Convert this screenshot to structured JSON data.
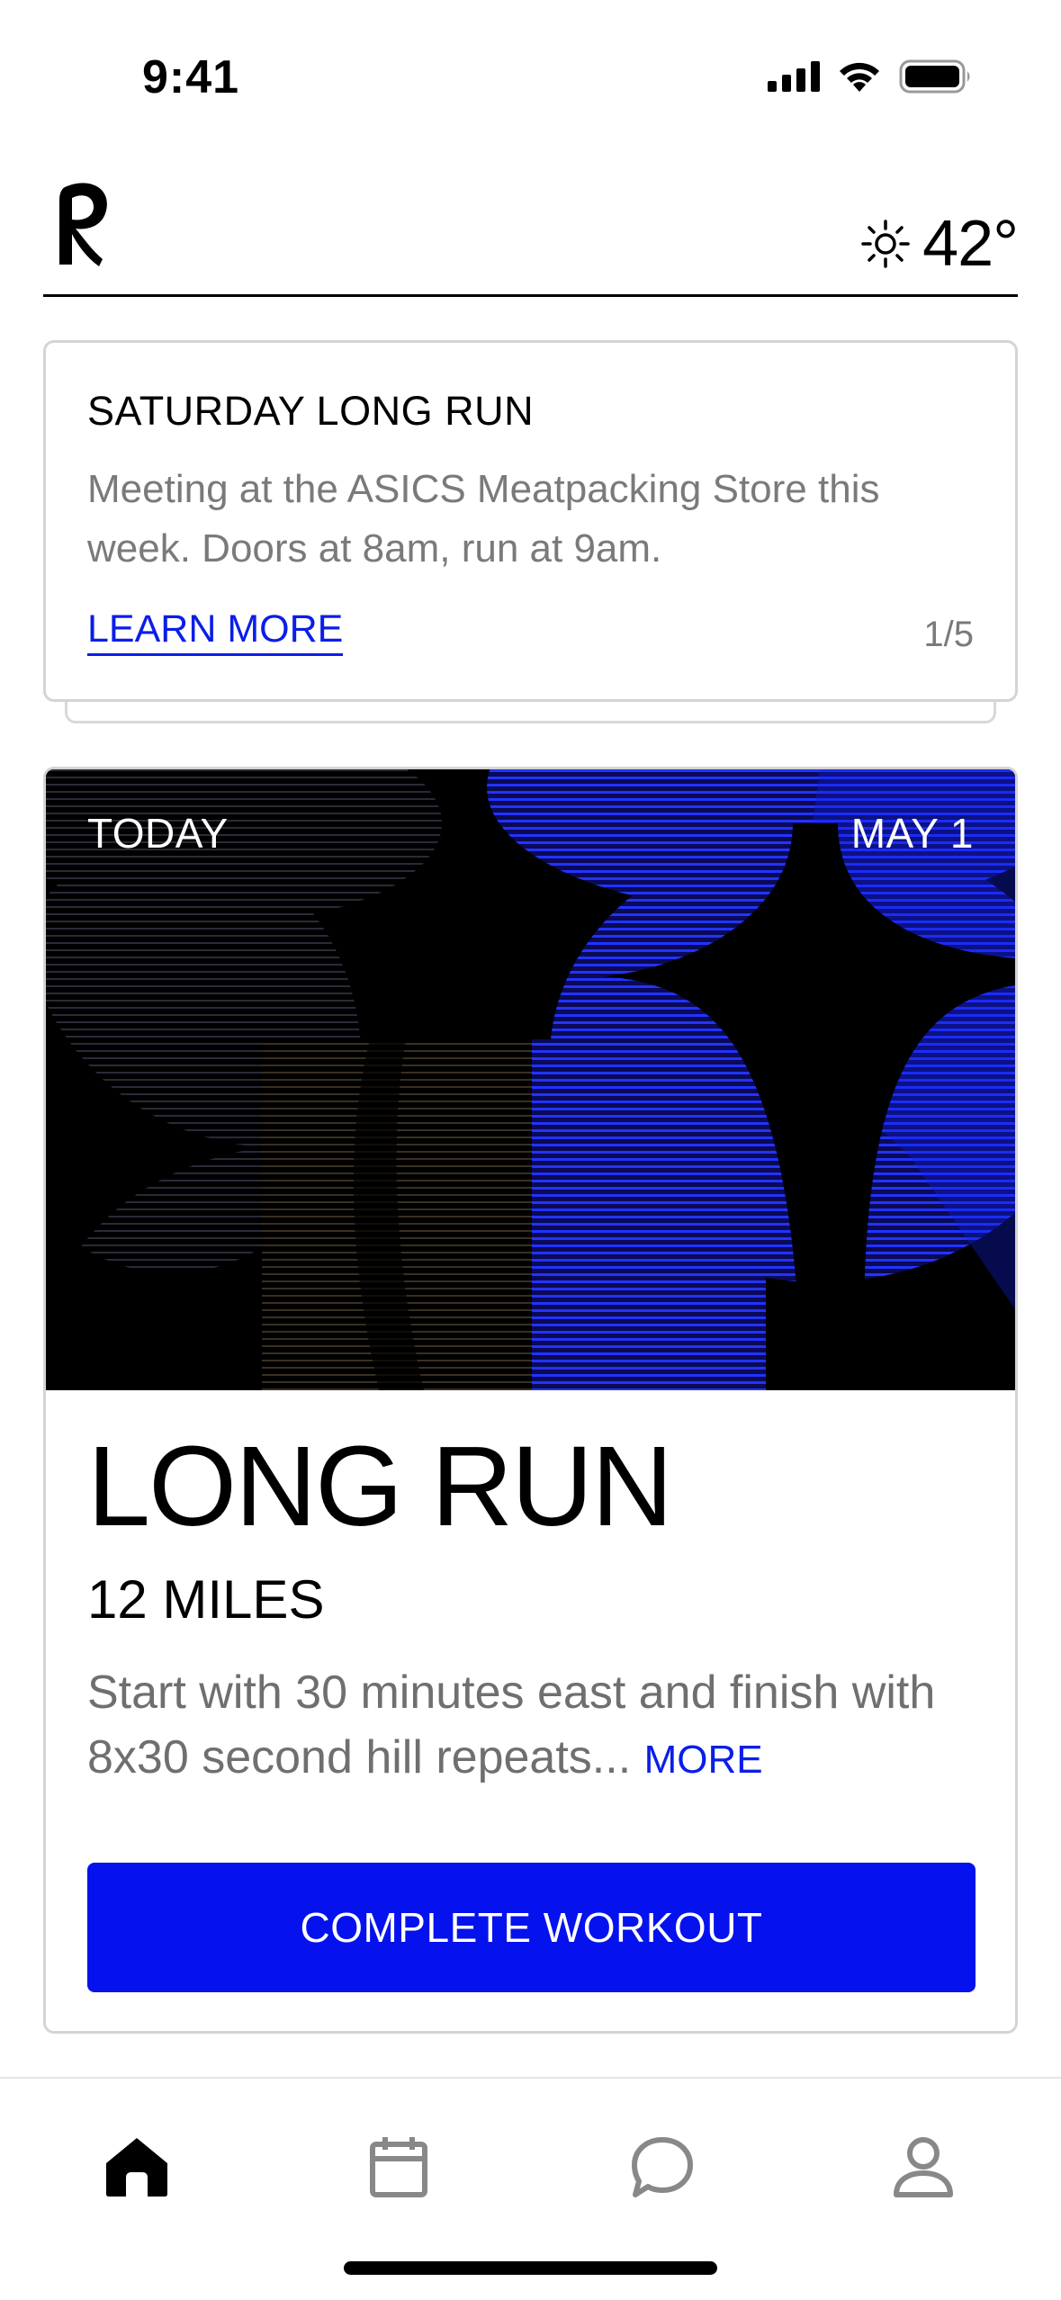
{
  "status_bar": {
    "time": "9:41"
  },
  "header": {
    "logo_icon": "brand-r-logo",
    "weather_icon": "sun-icon",
    "temperature": "42°"
  },
  "announcement": {
    "title": "SATURDAY LONG RUN",
    "body": "Meeting at the ASICS Meatpacking Store this week. Doors at 8am, run at 9am.",
    "link_label": "LEARN MORE",
    "pager": "1/5"
  },
  "workout": {
    "day_label": "TODAY",
    "date_label": "MAY 1",
    "title": "LONG RUN",
    "distance": "12 MILES",
    "description": "Start with 30 minutes east and finish with 8x30 second hill repeats...",
    "more_label": "MORE",
    "button_label": "COMPLETE WORKOUT"
  },
  "tab_bar": {
    "tabs": [
      {
        "icon": "home-icon",
        "active": true
      },
      {
        "icon": "calendar-icon",
        "active": false
      },
      {
        "icon": "chat-icon",
        "active": false
      },
      {
        "icon": "profile-icon",
        "active": false
      }
    ]
  },
  "colors": {
    "accent": "#0512ee",
    "hero_blue": "#1020e0",
    "muted_text": "#7a7a7a"
  }
}
